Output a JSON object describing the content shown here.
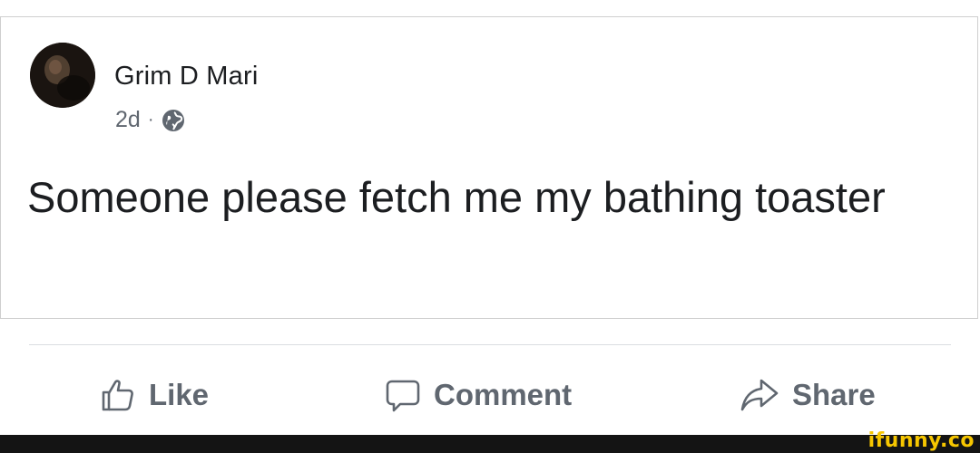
{
  "post": {
    "author": "Grim D Mari",
    "time": "2d",
    "separator": "·",
    "audience_icon": "globe-icon",
    "text": "Someone please fetch me my bathing toaster"
  },
  "actions": {
    "like": {
      "label": "Like",
      "icon": "thumbs-up-icon"
    },
    "comment": {
      "label": "Comment",
      "icon": "speech-bubble-icon"
    },
    "share": {
      "label": "Share",
      "icon": "share-arrow-icon"
    }
  },
  "watermark": {
    "text": "ifunny.co"
  },
  "colors": {
    "text_primary": "#1c1e21",
    "text_secondary": "#606770",
    "border": "#cfcfcf",
    "footer": "#141414",
    "watermark": "#f6c600"
  }
}
